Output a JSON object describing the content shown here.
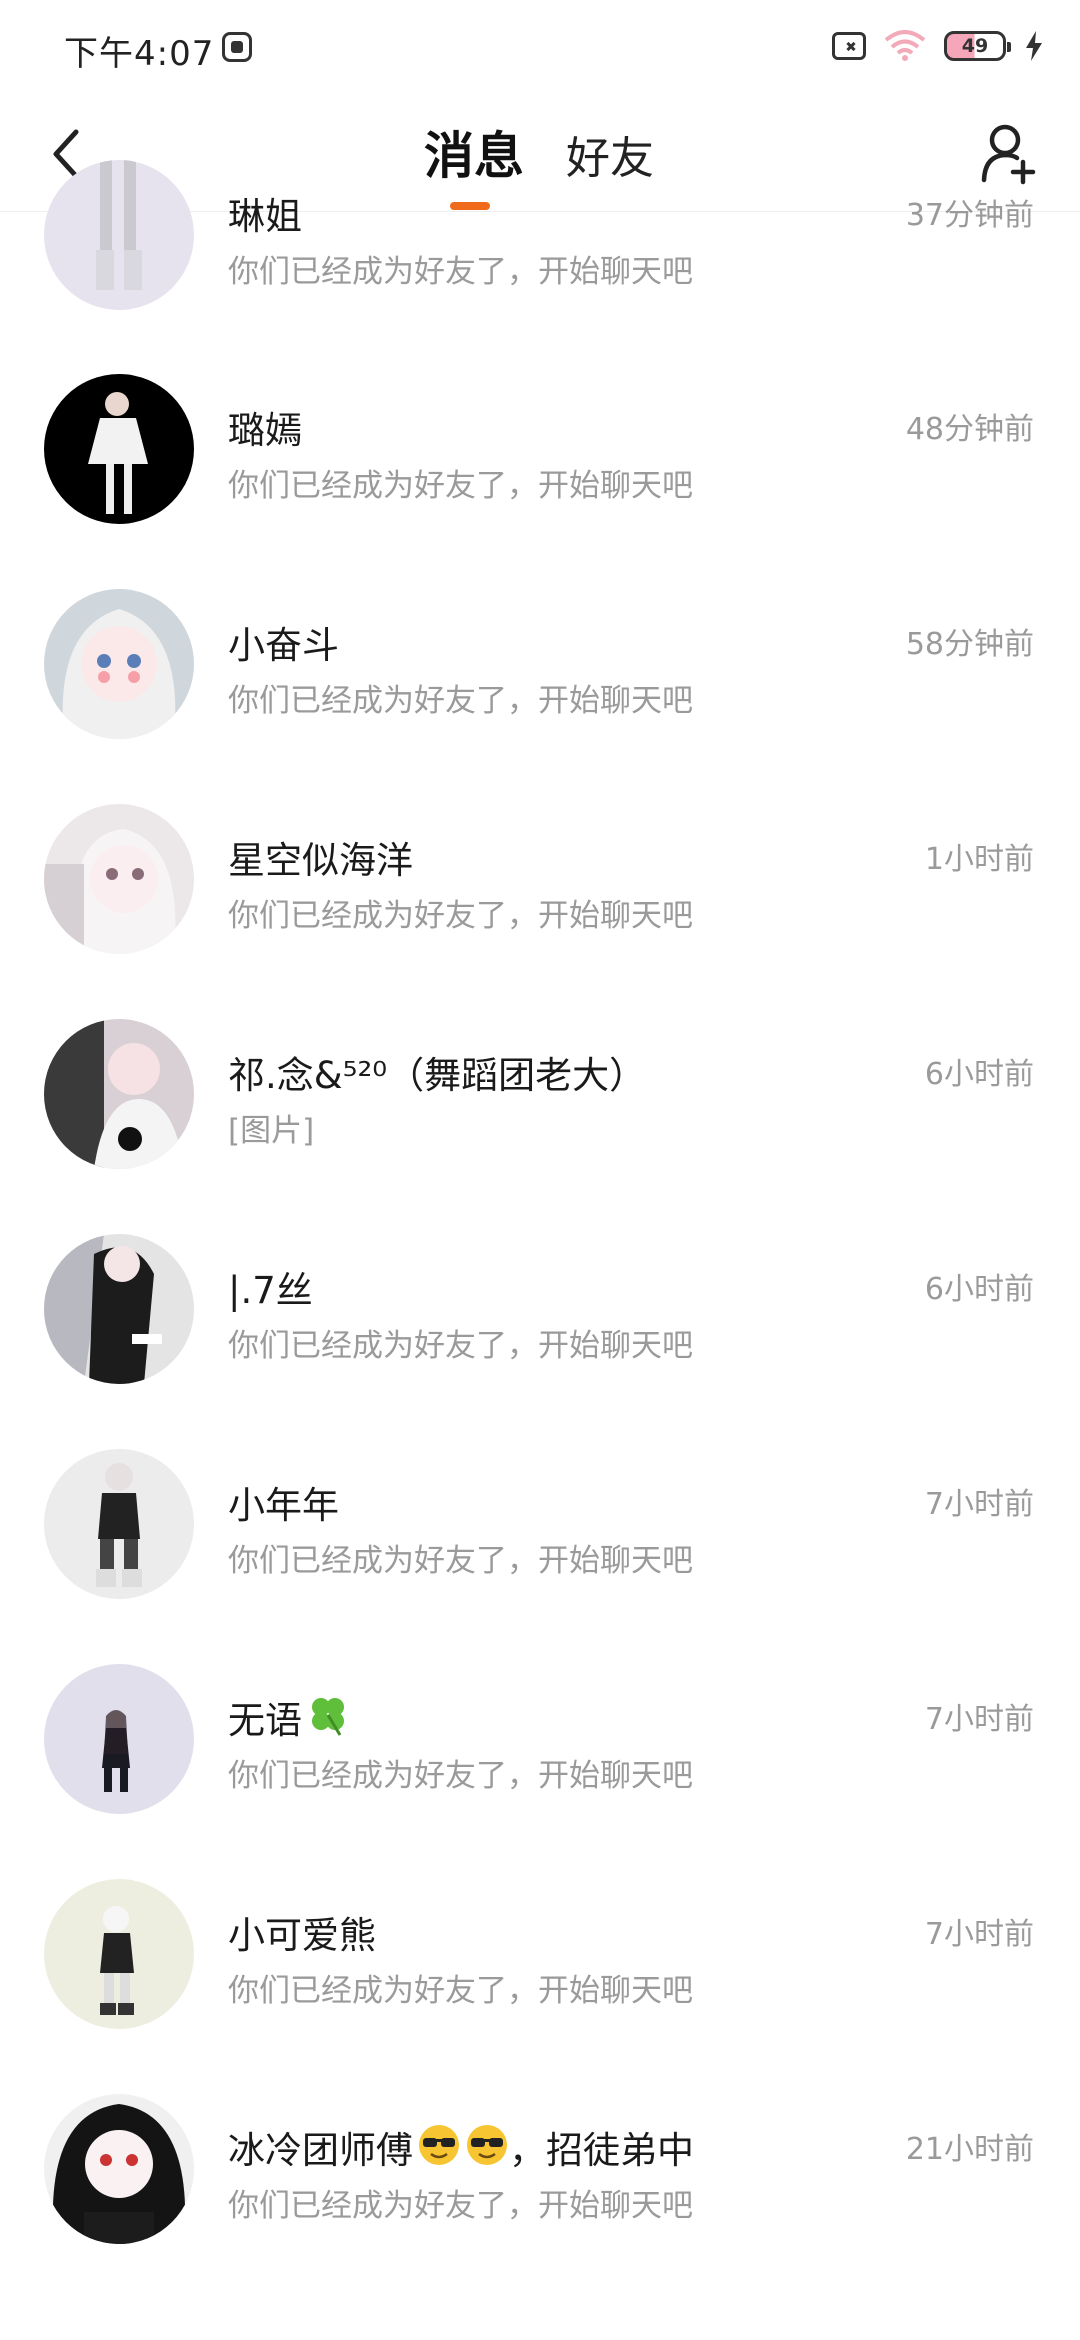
{
  "status_bar": {
    "time": "下午4:07",
    "battery_level": "49",
    "icons": [
      "app-icon",
      "sim-off-icon",
      "wifi-icon",
      "battery-icon",
      "charging-bolt-icon"
    ]
  },
  "header": {
    "tabs": [
      {
        "label": "消息",
        "active": true
      },
      {
        "label": "好友",
        "active": false
      }
    ],
    "accent_color": "#f06a1c",
    "icons": [
      "back-chevron-icon",
      "add-friend-icon"
    ]
  },
  "conversations": [
    {
      "name": "琳姐",
      "preview": "你们已经成为好友了，开始聊天吧",
      "time": "37分钟前",
      "avatar_color": "#e6e3ee"
    },
    {
      "name": "璐嫣",
      "preview": "你们已经成为好友了，开始聊天吧",
      "time": "48分钟前",
      "avatar_color": "#000000"
    },
    {
      "name": "小奋斗",
      "preview": "你们已经成为好友了，开始聊天吧",
      "time": "58分钟前",
      "avatar_color": "#cfd6dc"
    },
    {
      "name": "星空似海洋",
      "preview": "你们已经成为好友了，开始聊天吧",
      "time": "1小时前",
      "avatar_color": "#ece8ea"
    },
    {
      "name": "祁.念&⁵²⁰（舞蹈团老大）",
      "preview": "[图片]",
      "time": "6小时前",
      "avatar_color": "#d8d0d4"
    },
    {
      "name": "|.7丝",
      "preview": "你们已经成为好友了，开始聊天吧",
      "time": "6小时前",
      "avatar_color": "#e4e4e4"
    },
    {
      "name": "小年年",
      "preview": "你们已经成为好友了，开始聊天吧",
      "time": "7小时前",
      "avatar_color": "#ececec"
    },
    {
      "name": "无语",
      "name_emoji": "four-leaf-clover",
      "preview": "你们已经成为好友了，开始聊天吧",
      "time": "7小时前",
      "avatar_color": "#e2dfec"
    },
    {
      "name": "小可爱熊",
      "preview": "你们已经成为好友了，开始聊天吧",
      "time": "7小时前",
      "avatar_color": "#eeeee0"
    },
    {
      "name": "冰冷团师傅",
      "name_emoji": "sunglasses-face x2",
      "name_suffix": "，招徒弟中",
      "preview": "你们已经成为好友了，开始聊天吧",
      "time": "21小时前",
      "avatar_color": "#f0f0f0"
    }
  ]
}
